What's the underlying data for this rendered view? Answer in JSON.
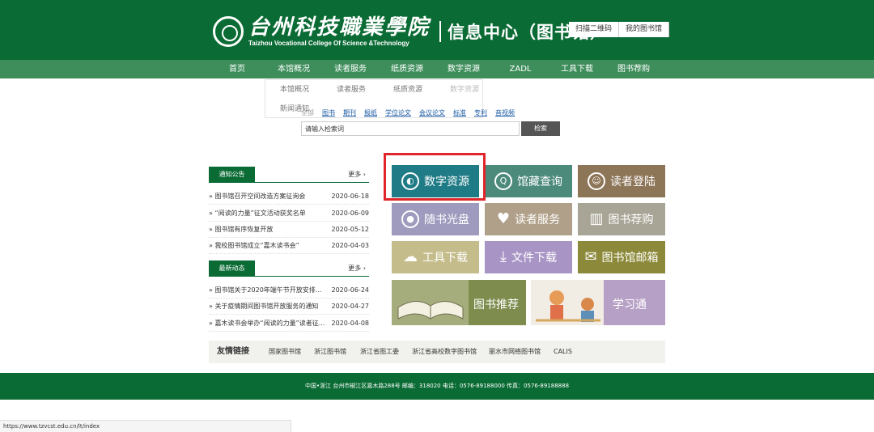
{
  "header": {
    "logo_cn": "台州科技職業學院",
    "logo_en": "Taizhou Vocational College Of Science &Technology",
    "subtitle": "信息中心（图书馆）",
    "btn_qr": "扫描二维码",
    "btn_my": "我的图书馆"
  },
  "nav": [
    "首页",
    "本馆概况",
    "读者服务",
    "纸质资源",
    "数字资源",
    "ZADL",
    "工具下载",
    "图书荐购"
  ],
  "dropdown": [
    "本馆概况",
    "读者服务",
    "纸质资源",
    "数字资源",
    "新闻通知"
  ],
  "search": {
    "tabs": [
      "全部",
      "图书",
      "期刊",
      "报纸",
      "学位论文",
      "会议论文",
      "标准",
      "专利",
      "音视频"
    ],
    "placeholder": "请输入检索词",
    "button": "检索"
  },
  "notices": {
    "title": "通知公告",
    "more": "更多",
    "items": [
      {
        "title": "» 图书馆召开空间改造方案征询会",
        "date": "2020-06-18"
      },
      {
        "title": "» “阅读的力量”征文活动获奖名单",
        "date": "2020-06-09"
      },
      {
        "title": "» 图书馆有序恢复开放",
        "date": "2020-05-12"
      },
      {
        "title": "» 我校图书馆成立“嘉木读书会”",
        "date": "2020-04-03"
      }
    ]
  },
  "news": {
    "title": "最新动态",
    "more": "更多",
    "items": [
      {
        "title": "» 图书馆关于2020年端午节开放安排...",
        "date": "2020-06-24"
      },
      {
        "title": "» 关于疫情期间图书馆开放服务的通知",
        "date": "2020-04-27"
      },
      {
        "title": "» 嘉木读书会举办“阅读的力量”读者征...",
        "date": "2020-04-08"
      }
    ]
  },
  "tiles": {
    "digital": "数字资源",
    "catalog": "馆藏查询",
    "reader_login": "读者登陆",
    "cd": "随书光盘",
    "reader_service": "读者服务",
    "recommend": "图书荐购",
    "tools": "工具下载",
    "files": "文件下载",
    "mail": "图书馆邮箱",
    "book_rec": "图书推荐",
    "xuexitong": "学习通"
  },
  "tile_colors": {
    "digital": "#1f7b86",
    "catalog": "#4c8a7c",
    "reader_login": "#8d7558",
    "cd": "#9e9bbe",
    "reader_service": "#b0a089",
    "recommend": "#a8a596",
    "tools": "#c4bc8a",
    "files": "#a895c6",
    "mail": "#8c8a3a"
  },
  "links": {
    "title": "友情链接",
    "items": [
      "国家图书馆",
      "浙江图书馆",
      "浙江省图工委",
      "浙江省高校数字图书馆",
      "丽水市网络图书馆",
      "CALIS"
    ]
  },
  "footer": "中国•浙江 台州市椒江区嘉木路288号 邮编：318020 电话：0576-89188000 传真：0576-89188888",
  "statusbar": "https://www.tzvcst.edu.cn/lt/index"
}
